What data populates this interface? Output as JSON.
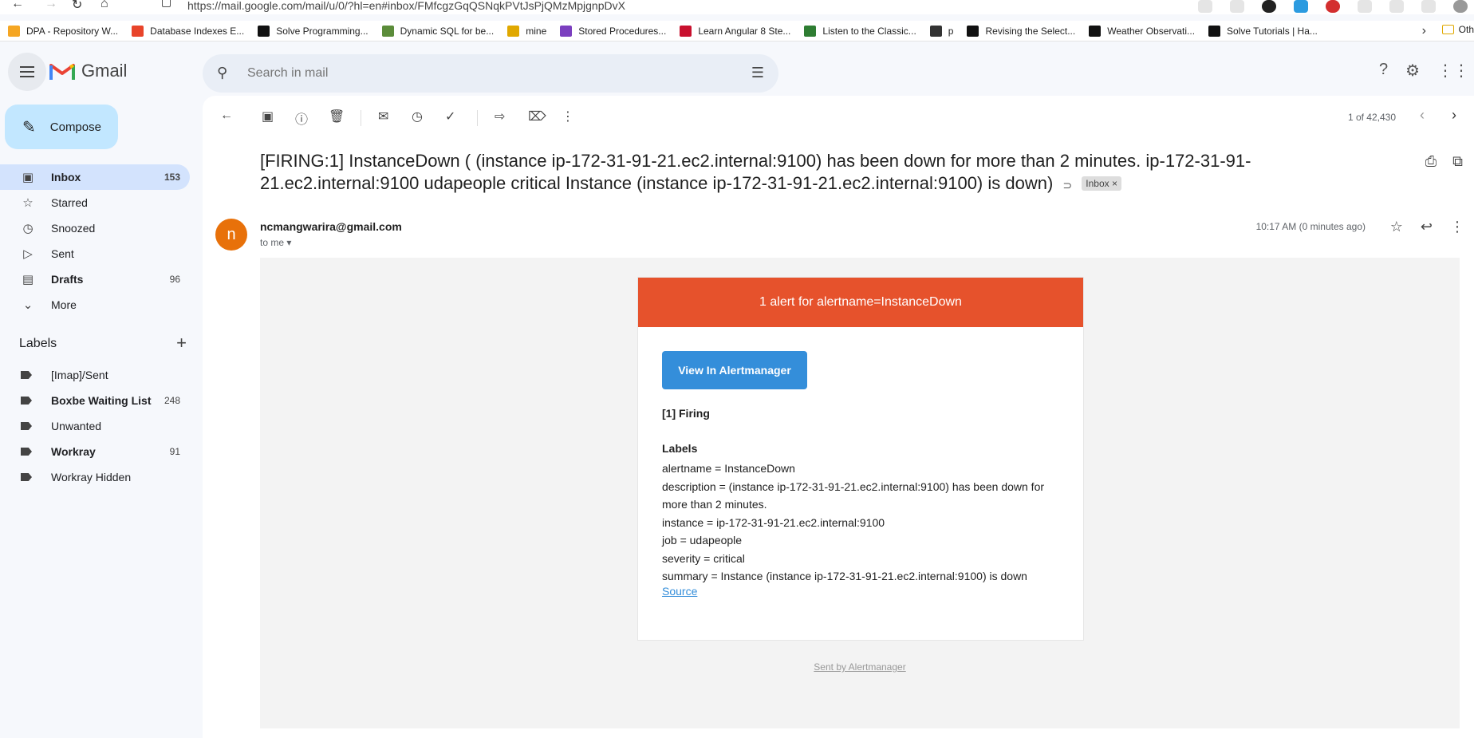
{
  "browser": {
    "url": "https://mail.google.com/mail/u/0/?hl=en#inbox/FMfcgzGqQSNqkPVtJsPjQMzMpjgnpDvX",
    "bookmarks": [
      {
        "label": "DPA - Repository W...",
        "color": "#f5a623"
      },
      {
        "label": "Database Indexes E...",
        "color": "#e8442a"
      },
      {
        "label": "Solve Programming...",
        "color": "#111111"
      },
      {
        "label": "Dynamic SQL for be...",
        "color": "#5b8c3a"
      },
      {
        "label": "mine",
        "color": "#e0a800"
      },
      {
        "label": "Stored Procedures...",
        "color": "#7b3fbf"
      },
      {
        "label": "Learn Angular 8 Ste...",
        "color": "#c8102e"
      },
      {
        "label": "Listen to the Classic...",
        "color": "#2e7d32"
      },
      {
        "label": "p",
        "color": "#333333"
      },
      {
        "label": "Revising the Select...",
        "color": "#111111"
      },
      {
        "label": "Weather Observati...",
        "color": "#111111"
      },
      {
        "label": "Solve Tutorials | Ha...",
        "color": "#111111"
      }
    ],
    "other_bookmarks": "Oth"
  },
  "header": {
    "app_name": "Gmail",
    "search_placeholder": "Search in mail"
  },
  "sidebar": {
    "compose_label": "Compose",
    "items": [
      {
        "label": "Inbox",
        "count": "153",
        "icon": "inbox-icon"
      },
      {
        "label": "Starred",
        "count": "",
        "icon": "star-icon"
      },
      {
        "label": "Snoozed",
        "count": "",
        "icon": "clock-icon"
      },
      {
        "label": "Sent",
        "count": "",
        "icon": "send-icon"
      },
      {
        "label": "Drafts",
        "count": "96",
        "icon": "draft-icon"
      },
      {
        "label": "More",
        "count": "",
        "icon": "chevron-down-icon"
      }
    ],
    "labels_heading": "Labels",
    "labels": [
      {
        "label": "[Imap]/Sent",
        "count": ""
      },
      {
        "label": "Boxbe Waiting List",
        "count": "248"
      },
      {
        "label": "Unwanted",
        "count": ""
      },
      {
        "label": "Workray",
        "count": "91"
      },
      {
        "label": "Workray Hidden",
        "count": ""
      }
    ]
  },
  "toolbar": {
    "pager": "1 of 42,430"
  },
  "message": {
    "subject": "[FIRING:1] InstanceDown ( (instance ip-172-31-91-21.ec2.internal:9100) has been down for more than 2 minutes. ip-172-31-91-21.ec2.internal:9100 udapeople critical Instance (instance ip-172-31-91-21.ec2.internal:9100) is down)",
    "inbox_badge": "Inbox ×",
    "avatar_letter": "n",
    "sender": "ncmangwarira@gmail.com",
    "to": "to me",
    "time": "10:17 AM (0 minutes ago)"
  },
  "alert": {
    "header": "1 alert for alertname=InstanceDown",
    "button": "View In Alertmanager",
    "firing": "[1] Firing",
    "labels_heading": "Labels",
    "lines": [
      "alertname = InstanceDown",
      "description = (instance ip-172-31-91-21.ec2.internal:9100) has been down for",
      "more than 2 minutes.",
      "instance = ip-172-31-91-21.ec2.internal:9100",
      "job = udapeople",
      "severity = critical",
      "summary = Instance (instance ip-172-31-91-21.ec2.internal:9100) is down"
    ],
    "source_link": "Source",
    "footer": "Sent by Alertmanager"
  }
}
